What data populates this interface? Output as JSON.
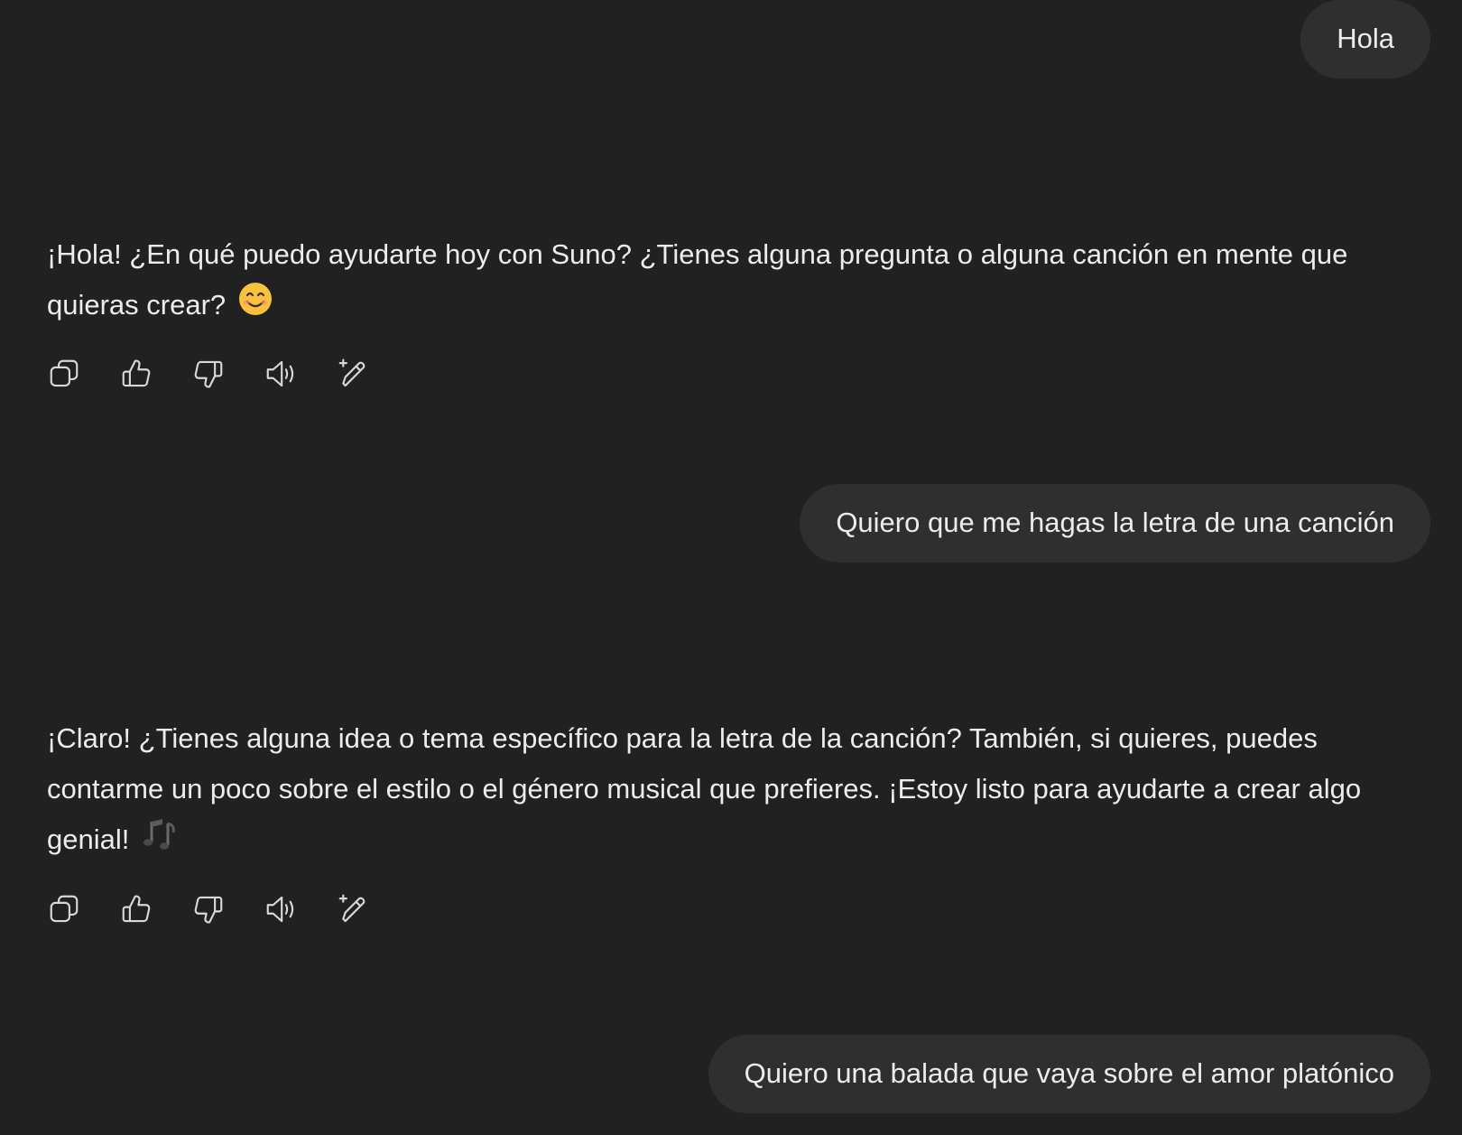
{
  "messages": [
    {
      "role": "user",
      "text": "Hola"
    },
    {
      "role": "assistant",
      "text": "¡Hola! ¿En qué puedo ayudarte hoy con Suno? ¿Tienes alguna pregunta o alguna canción en mente que quieras crear?",
      "emoji": "smiling-face-emoji"
    },
    {
      "role": "user",
      "text": "Quiero que me hagas la letra de una canción"
    },
    {
      "role": "assistant",
      "text": "¡Claro! ¿Tienes alguna idea o tema específico para la letra de la canción? También, si quieres, puedes contarme un poco sobre el estilo o el género musical que prefieres. ¡Estoy listo para ayudarte a crear algo genial!",
      "emoji": "musical-notes-emoji"
    },
    {
      "role": "user",
      "text": "Quiero una balada que vaya sobre el amor platónico"
    }
  ],
  "actions": [
    "copy-icon",
    "thumbs-up-icon",
    "thumbs-down-icon",
    "read-aloud-icon",
    "edit-sparkle-icon"
  ],
  "colors": {
    "background": "#212121",
    "user_bubble": "#2f2f2f",
    "text": "#ececec",
    "icon": "#d8d8d8",
    "emoji_face": "#f9c23c"
  }
}
